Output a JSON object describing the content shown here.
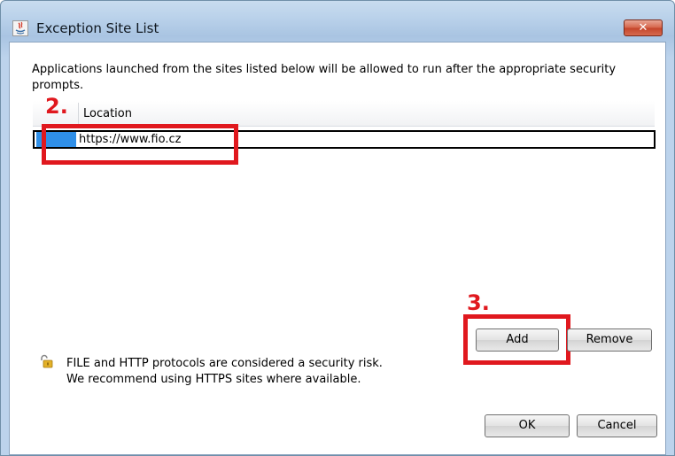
{
  "window": {
    "title": "Exception Site List",
    "close_label": "✕"
  },
  "description": "Applications launched from the sites listed below will be allowed to run after the appropriate security prompts.",
  "table": {
    "columns": [
      "",
      "Location"
    ],
    "rows": [
      {
        "url": "https://www.fio.cz"
      }
    ]
  },
  "annotations": {
    "step2": "2.",
    "step3": "3."
  },
  "buttons": {
    "add": "Add",
    "remove": "Remove",
    "ok": "OK",
    "cancel": "Cancel"
  },
  "warning": {
    "line1": "FILE and HTTP protocols are considered a security risk.",
    "line2": "We recommend using HTTPS sites where available."
  },
  "colors": {
    "annotation_red": "#e0181e",
    "selection_blue": "#2f8fe8"
  }
}
